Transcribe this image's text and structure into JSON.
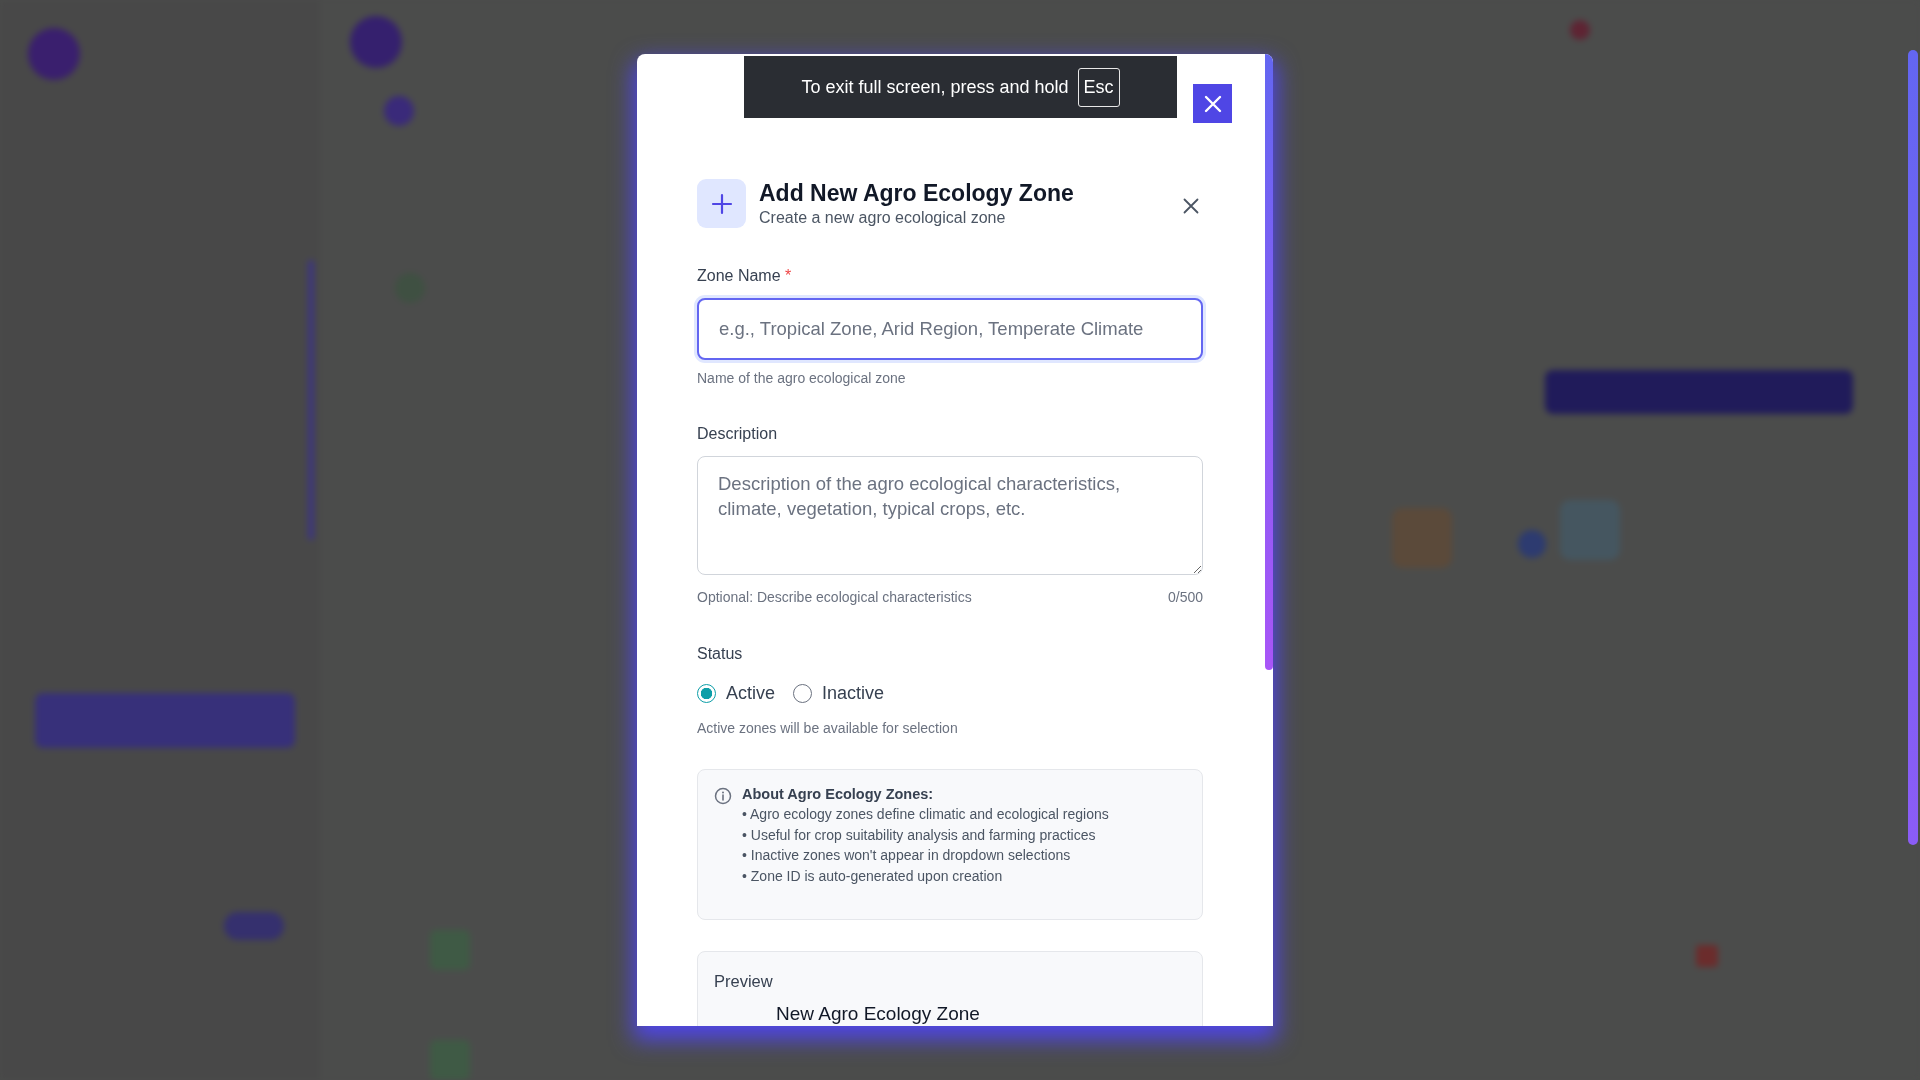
{
  "fullscreen_notice": {
    "text": "To exit full screen, press and hold",
    "key": "Esc"
  },
  "dialog": {
    "title": "Add New Agro Ecology Zone",
    "subtitle": "Create a new agro ecological zone",
    "fields": [
      {
        "kind": "input",
        "label": "Zone Name",
        "required_mark": "*",
        "placeholder": "e.g., Tropical Zone, Arid Region, Temperate Climate",
        "hint": "Name of the agro ecological zone"
      },
      {
        "kind": "textarea",
        "label": "Description",
        "placeholder": "Description of the agro ecological characteristics, climate, vegetation, typical crops, etc.",
        "hint": "Optional: Describe ecological characteristics",
        "counter": "0/500"
      }
    ],
    "status": {
      "label": "Status",
      "options": [
        {
          "label": "Active",
          "selected": true
        },
        {
          "label": "Inactive",
          "selected": false
        }
      ],
      "hint": "Active zones will be available for selection"
    },
    "info": {
      "title": "About Agro Ecology Zones:",
      "items": [
        "• Agro ecology zones define climatic and ecological regions",
        "• Useful for crop suitability analysis and farming practices",
        "• Inactive zones won't appear in dropdown selections",
        "• Zone ID is auto-generated upon creation"
      ]
    },
    "preview": {
      "label": "Preview",
      "name": "New Agro Ecology Zone"
    }
  }
}
